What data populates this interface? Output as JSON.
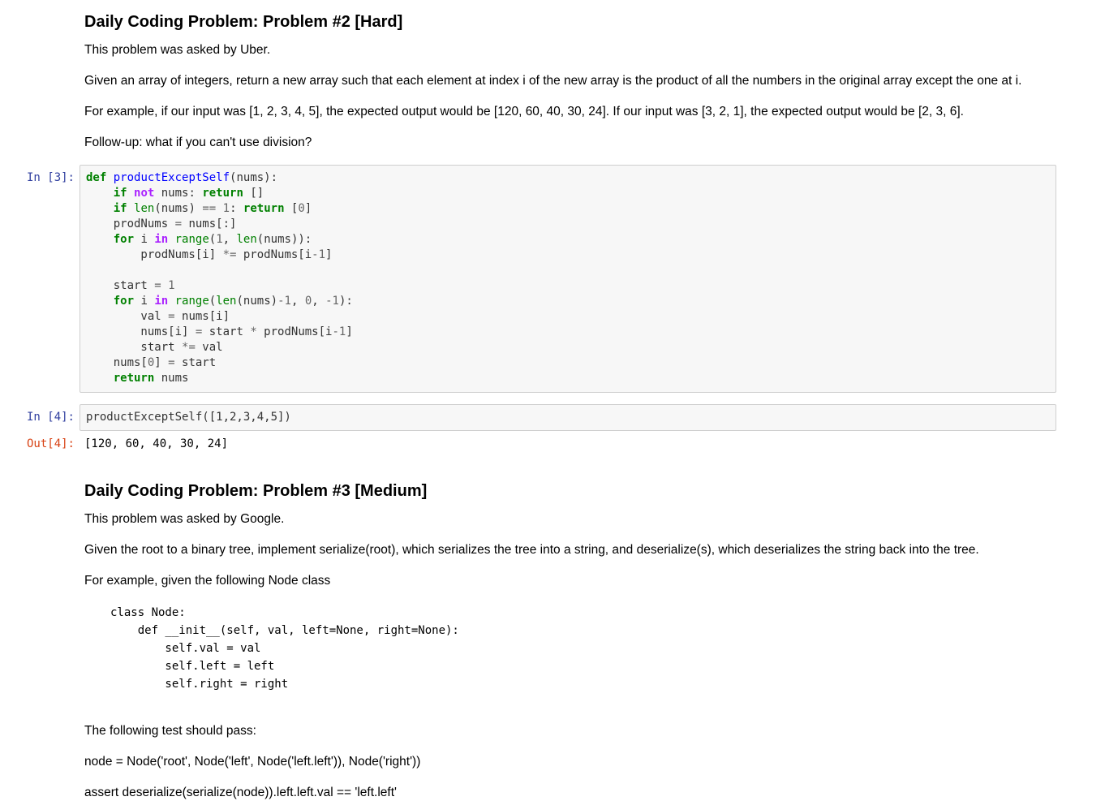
{
  "section1": {
    "title": "Daily Coding Problem: Problem #2 [Hard]",
    "asked_by": "This problem was asked by Uber.",
    "description": "Given an array of integers, return a new array such that each element at index i of the new array is the product of all the numbers in the original array except the one at i.",
    "example": "For example, if our input was [1, 2, 3, 4, 5], the expected output would be [120, 60, 40, 30, 24]. If our input was [3, 2, 1], the expected output would be [2, 3, 6].",
    "followup": "Follow-up: what if you can't use division?"
  },
  "cells": {
    "cell3_prompt": "In [3]:",
    "cell4_prompt": "In [4]:",
    "cell4_code": "productExceptSelf([1,2,3,4,5])",
    "out4_prompt": "Out[4]:",
    "out4_text": "[120, 60, 40, 30, 24]"
  },
  "section2": {
    "title": "Daily Coding Problem: Problem #3 [Medium]",
    "asked_by": "This problem was asked by Google.",
    "description": "Given the root to a binary tree, implement serialize(root), which serializes the tree into a string, and deserialize(s), which deserializes the string back into the tree.",
    "example_intro": "For example, given the following Node class",
    "code_lines": [
      "class Node:",
      "    def __init__(self, val, left=None, right=None):",
      "        self.val = val",
      "        self.left = left",
      "        self.right = right"
    ],
    "test_intro": "The following test should pass:",
    "test_node": "node = Node('root', Node('left', Node('left.left')), Node('right'))",
    "test_assert": "assert deserialize(serialize(node)).left.left.val == 'left.left'"
  }
}
